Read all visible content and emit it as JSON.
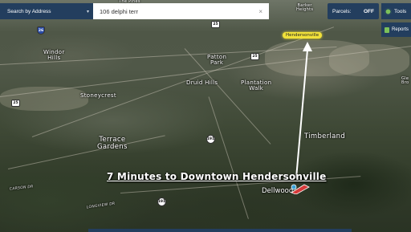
{
  "search": {
    "mode_label": "Search by Address",
    "query": "106 delphi terr",
    "clear": "×"
  },
  "toolbar": {
    "parcels_label": "Parcels:",
    "parcels_state": "OFF",
    "tools_label": "Tools",
    "reports_label": "Reports"
  },
  "map": {
    "headline": "7 Minutes to Downtown Hendersonville",
    "hendersonville_label": "Hendersonville",
    "dellwood_label": "Dellwood",
    "places": {
      "windor_hills": "Windor\nHills",
      "patton_park": "Patton\nPark",
      "druid_hills": "Druid Hills",
      "plantation_walk": "Plantation\nWalk",
      "stoneycrest": "Stoneycrest",
      "terrace_gardens": "Terrace\nGardens",
      "timberland": "Timberland",
      "barker_heights": "Barker\nHeights",
      "the_pines": "The Pines",
      "glen": "Gle\nBro"
    },
    "roads": {
      "carson_dr": "CARSON DR",
      "longview_dr": "LONGVIEW DR"
    },
    "shields": {
      "us25_nw": "25",
      "i26": "26",
      "r191_mid": "191",
      "r191_low": "191",
      "r25_left": "25",
      "r25_mid": "25"
    }
  },
  "colors": {
    "chrome": "#233e5e",
    "accent": "#7cc15a",
    "town_highlight": "#f1e13a",
    "route_arrow": "#ffffff",
    "pin": "#d63a3a"
  }
}
